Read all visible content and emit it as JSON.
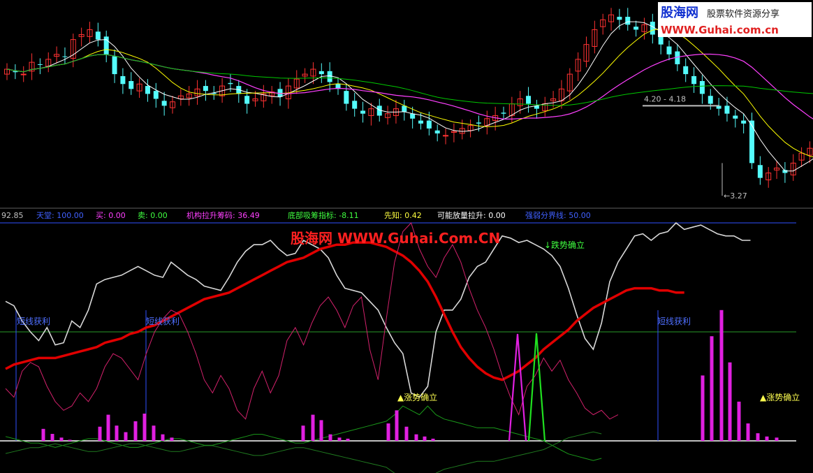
{
  "watermark_tr": {
    "line1": "股海网",
    "line2": "股票软件资源分享",
    "line3": "WWW.Guhai.com.cn"
  },
  "watermark_mid": "股海网 WWW.Guhai.Com.CN",
  "indicator_bar": [
    {
      "text": "92.85",
      "color": "#c0c0c0"
    },
    {
      "text": "天堂: 100.00",
      "color": "#4060ff"
    },
    {
      "text": "买: 0.00",
      "color": "#ff40ff"
    },
    {
      "text": "卖: 0.00",
      "color": "#40ff40"
    },
    {
      "text": "机构拉升筹码: 36.49",
      "color": "#ff40ff"
    },
    {
      "text": "底部吸筹指标: -8.11",
      "color": "#40ff40"
    },
    {
      "text": "先知: 0.42",
      "color": "#ffff40"
    },
    {
      "text": "可能放量拉升: 0.00",
      "color": "#ffffff"
    },
    {
      "text": "强弱分界线: 50.00",
      "color": "#4060ff"
    }
  ],
  "colors": {
    "up": "#ff3232",
    "down": "#54fcfc",
    "ma5": "#ffffff",
    "ma10": "#ffff00",
    "ma20": "#ff40ff",
    "ma60": "#00c800",
    "main_line": "#e00000"
  },
  "chart_data": [
    {
      "type": "candlestick",
      "price_annotations": [
        {
          "text": "4.20 - 4.18"
        },
        {
          "text": "3.27"
        }
      ],
      "close": [
        4.55,
        4.52,
        4.5,
        4.62,
        4.6,
        4.65,
        4.7,
        4.68,
        4.85,
        4.9,
        4.95,
        4.85,
        4.7,
        4.5,
        4.4,
        4.35,
        4.4,
        4.3,
        4.25,
        4.18,
        4.22,
        4.28,
        4.3,
        4.35,
        4.33,
        4.3,
        4.38,
        4.4,
        4.3,
        4.2,
        4.25,
        4.3,
        4.32,
        4.27,
        4.38,
        4.45,
        4.5,
        4.55,
        4.5,
        4.42,
        4.35,
        4.2,
        4.15,
        4.1,
        4.15,
        4.08,
        4.1,
        4.15,
        4.12,
        4.05,
        4.0,
        3.95,
        3.9,
        3.88,
        3.92,
        3.95,
        3.98,
        4.0,
        4.05,
        4.08,
        4.1,
        4.2,
        4.25,
        4.2,
        4.15,
        4.2,
        4.25,
        4.35,
        4.5,
        4.65,
        4.8,
        4.95,
        5.05,
        5.1,
        5.05,
        5.0,
        4.95,
        5.0,
        4.9,
        4.8,
        4.7,
        4.6,
        4.5,
        4.4,
        4.3,
        4.2,
        4.15,
        4.1,
        4.05,
        4.0,
        3.6,
        3.45,
        3.5,
        3.55,
        3.5,
        3.6,
        3.7,
        3.75,
        3.85
      ]
    },
    {
      "type": "line",
      "series": [
        {
          "name": "天堂",
          "values": [
            100
          ]
        },
        {
          "name": "买",
          "values": [
            0
          ]
        },
        {
          "name": "卖",
          "values": [
            0
          ]
        },
        {
          "name": "机构拉升筹码",
          "values": [
            36.49
          ]
        },
        {
          "name": "底部吸筹指标",
          "values": [
            -8.11
          ]
        },
        {
          "name": "先知",
          "values": [
            0.42
          ]
        },
        {
          "name": "可能放量拉升",
          "values": [
            0
          ]
        },
        {
          "name": "强弱分界线",
          "values": [
            50
          ]
        }
      ],
      "annotations": [
        {
          "text": "短线获利"
        },
        {
          "text": "短线获利"
        },
        {
          "text": "短线获利"
        },
        {
          "text": "▲涨势确立"
        },
        {
          "text": "▲涨势确立"
        },
        {
          "text": "↓跌势确立"
        }
      ]
    }
  ]
}
